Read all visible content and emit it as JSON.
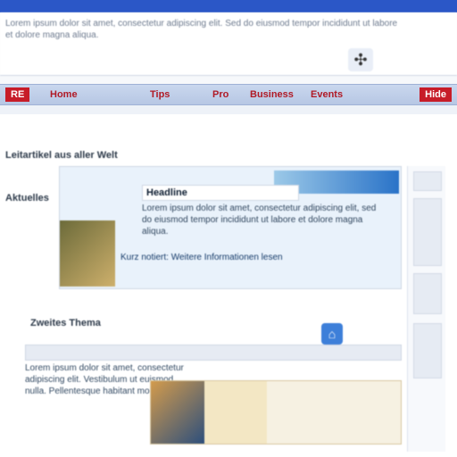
{
  "window": {
    "top_bar_text": "Lorem ipsum dolor sit amet, consectetur adipiscing elit. Sed do eiusmod tempor incididunt ut labore et dolore magna aliqua.",
    "badge_glyph": "✣"
  },
  "nav": {
    "left_tag": "RE",
    "items": [
      "Home",
      "Tips",
      "Pro",
      "Business",
      "Events"
    ],
    "right_tag": "Hide"
  },
  "main": {
    "section_title": "Leitartikel aus aller Welt",
    "aside_title": "Aktuelles",
    "hero": {
      "title": "Headline",
      "text": "Lorem ipsum dolor sit amet, consectetur adipiscing elit, sed do eiusmod tempor incididunt ut labore et dolore magna aliqua.",
      "tagline": "Kurz notiert: Weitere Informationen lesen"
    },
    "block2": {
      "head": "Zweites Thema",
      "icon": "⌂",
      "list": "Lorem ipsum dolor sit amet, consectetur adipiscing elit.\nVestibulum ut euismod nulla.\nPellentesque habitant morbi."
    }
  },
  "colors": {
    "brand_blue": "#2b57c7",
    "nav_red": "#c71c28",
    "nav_bar": "#b7c7e4"
  }
}
